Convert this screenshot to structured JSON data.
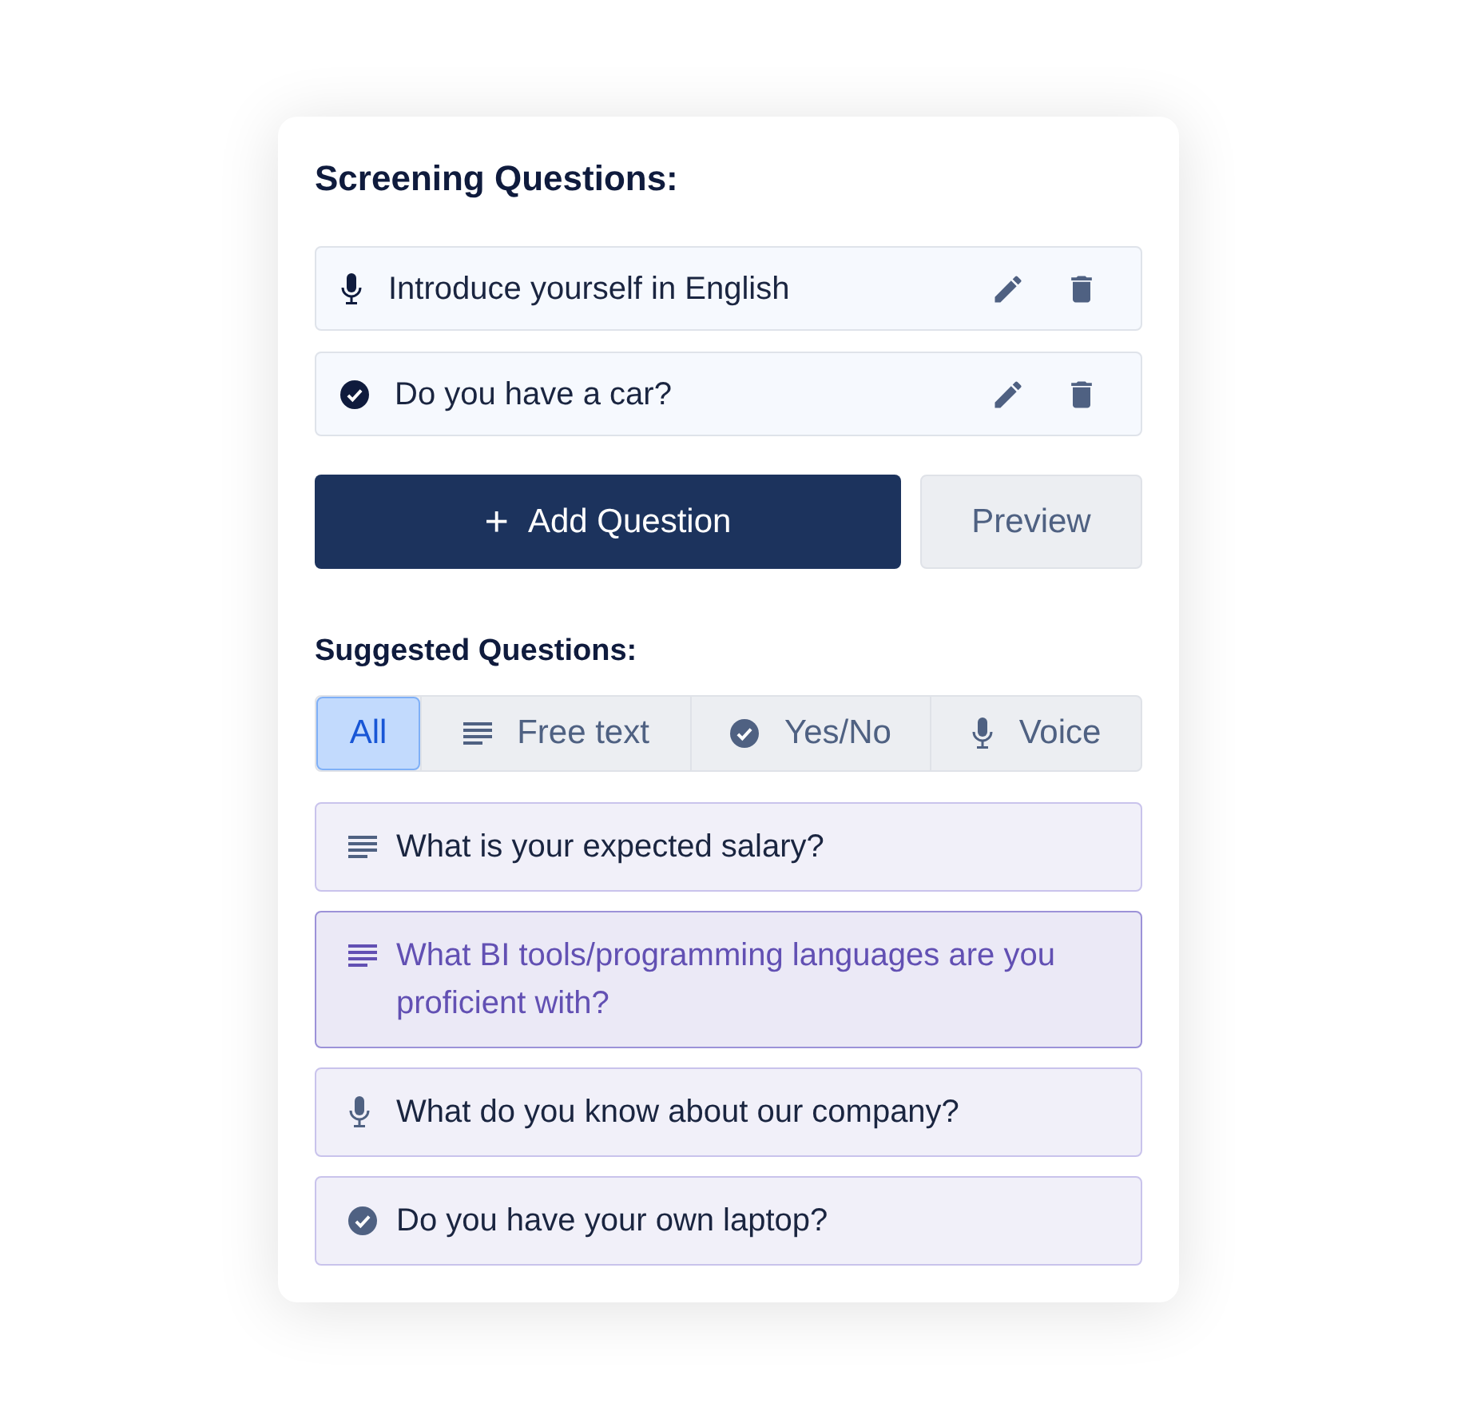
{
  "screening": {
    "title": "Screening Questions:",
    "questions": [
      {
        "kind": "voice",
        "text": "Introduce yourself in English"
      },
      {
        "kind": "yesno",
        "text": "Do you have a car?"
      }
    ],
    "add_button": {
      "icon": "+",
      "label": "Add Question"
    },
    "preview_button": "Preview"
  },
  "suggested": {
    "title": "Suggested Questions:",
    "filters": [
      {
        "kind": "all",
        "label": "All",
        "selected": true
      },
      {
        "kind": "text",
        "label": "Free text",
        "selected": false
      },
      {
        "kind": "yesno",
        "label": "Yes/No",
        "selected": false
      },
      {
        "kind": "voice",
        "label": "Voice",
        "selected": false
      }
    ],
    "questions": [
      {
        "kind": "text",
        "text": "What is your expected salary?",
        "selected": false
      },
      {
        "kind": "text",
        "text": "What BI tools/programming languages are you proficient with?",
        "selected": true
      },
      {
        "kind": "voice",
        "text": "What do you know about our company?",
        "selected": false
      },
      {
        "kind": "yesno",
        "text": "Do you have your own laptop?",
        "selected": false
      }
    ]
  }
}
